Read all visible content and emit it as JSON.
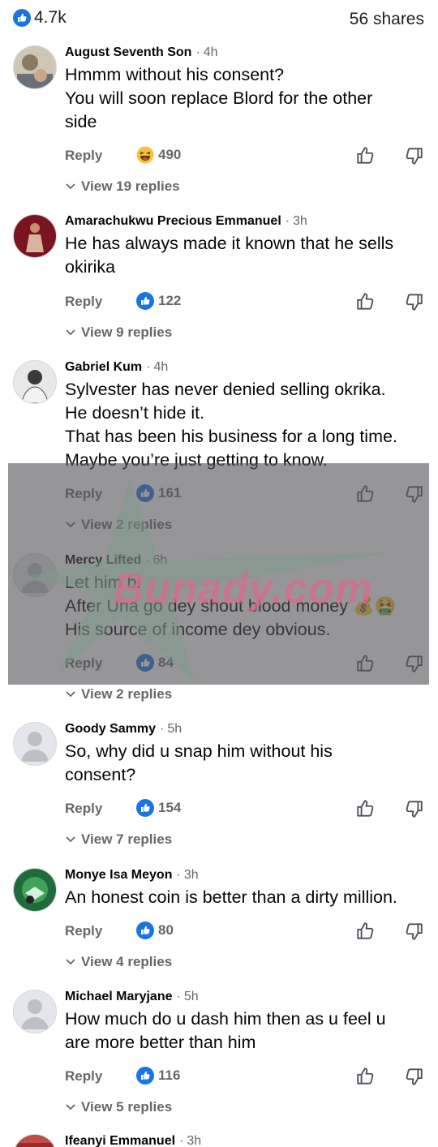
{
  "header": {
    "likes_count": "4.7k",
    "shares": "56 shares"
  },
  "comments": [
    {
      "name": "August Seventh Son",
      "time": "4h",
      "lines": [
        "Hmmm without his consent?",
        "You will soon replace Blord for the other",
        "side"
      ],
      "reply": "Reply",
      "reaction_icon": "laugh-emoji-icon",
      "reaction_count": "490",
      "view_replies": "View 19 replies"
    },
    {
      "name": "Amarachukwu Precious Emmanuel",
      "time": "3h",
      "lines": [
        "He has always made it known that he sells",
        "okirika"
      ],
      "reply": "Reply",
      "reaction_icon": "like-icon",
      "reaction_count": "122",
      "view_replies": "View 9 replies"
    },
    {
      "name": "Gabriel Kum",
      "time": "4h",
      "lines": [
        "Sylvester has never denied selling okrika.",
        "He doesn’t hide it.",
        "That has been his business for a long time.",
        "Maybe you’re just getting to know."
      ],
      "reply": "Reply",
      "reaction_icon": "like-icon",
      "reaction_count": "161",
      "view_replies": "View 2 replies"
    },
    {
      "name": "Mercy Lifted",
      "time": "6h",
      "lines": [
        "Let him bi",
        "After Una go dey shout blood money 💰🤮",
        "His source of income dey obvious."
      ],
      "reply": "Reply",
      "reaction_icon": "like-icon",
      "reaction_count": "84",
      "view_replies": "View 2 replies"
    },
    {
      "name": "Goody Sammy",
      "time": "5h",
      "lines": [
        "So, why did u snap him without his",
        "consent?"
      ],
      "reply": "Reply",
      "reaction_icon": "like-icon",
      "reaction_count": "154",
      "view_replies": "View 7 replies"
    },
    {
      "name": "Monye Isa Meyon",
      "time": "3h",
      "lines": [
        "An honest coin is better than a dirty million."
      ],
      "reply": "Reply",
      "reaction_icon": "like-icon",
      "reaction_count": "80",
      "view_replies": "View 4 replies"
    },
    {
      "name": "Michael Maryjane",
      "time": "5h",
      "lines": [
        "How much do u dash him then as u feel u",
        "are more better than him"
      ],
      "reply": "Reply",
      "reaction_icon": "like-icon",
      "reaction_count": "116",
      "view_replies": "View 5 replies"
    },
    {
      "name": "Ifeanyi Emmanuel",
      "time": "3h",
      "lines": []
    }
  ],
  "watermark": {
    "text": "Bunady.com"
  },
  "colors": {
    "like_blue": "#1b74e4",
    "meta_gray": "#65676b",
    "text": "#050505"
  }
}
